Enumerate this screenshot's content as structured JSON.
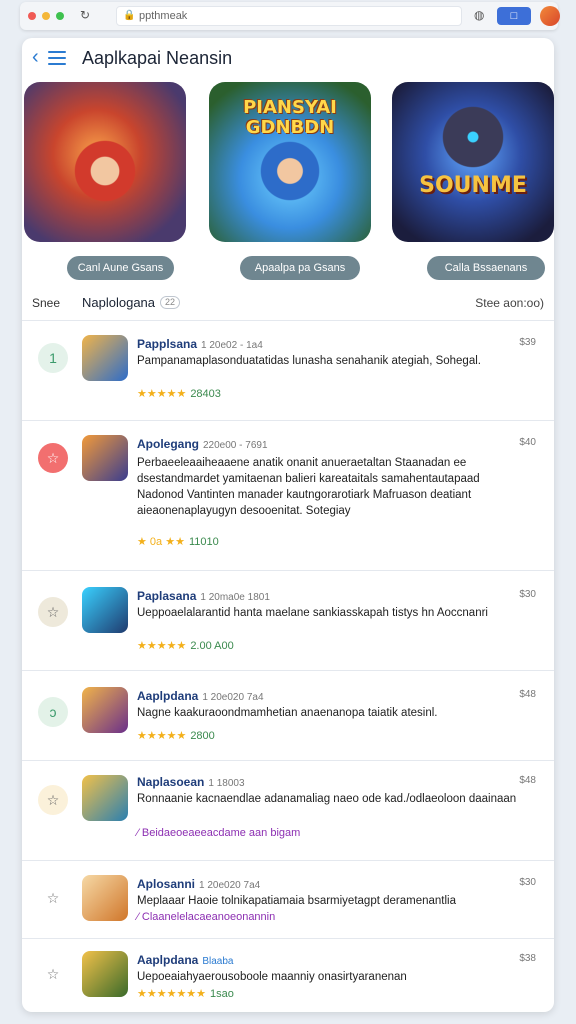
{
  "browser": {
    "url": "ppthmeak",
    "ext_label": "□",
    "profile_initial": "●"
  },
  "header": {
    "title": "Aaplkapai Neansin"
  },
  "hero": [
    {
      "art_text": "",
      "button": "Canl Aune Gsans"
    },
    {
      "art_text": "PIANSYAI GDNBDN",
      "button": "Apaalpa pa Gsans"
    },
    {
      "art_text": "SOUNME",
      "button": "Calla Bssaenans"
    }
  ],
  "filters": {
    "left": "Snee",
    "title": "Naplologana",
    "badge": "22",
    "right": "Stee aon:oo)"
  },
  "rows": [
    {
      "title": "Papplsana",
      "meta": "1 20e02 - 1a4",
      "desc": "Pampanamaplasonduatatidas lunasha senahanik ategiah, Sohegal.",
      "rating": "★★★★★",
      "rating_num": "28403",
      "count": "$39",
      "left_icon": "1",
      "left_bg": "#e4f2ea",
      "left_fg": "#3b9a6b",
      "thumb": "#2d6cc9"
    },
    {
      "title": "Apolegang",
      "meta": "220e00 - 7691",
      "desc": "Perbaeeleaaiheaaene anatik onanit anueraetaltan Staanadan ee dsestandmardet yamitaenan balieri kareataitals samahentautapaad Nadonod Vantinten manader kautngorarotiark Mafruason deatiant aieaonenaplayugyn desooenitat. Sotegiay",
      "rating": "★ 0a  ★★",
      "rating_num": "11010",
      "count": "$40",
      "left_icon": "☆",
      "left_bg": "#f26f6f",
      "left_fg": "#ffffff",
      "thumb": "#3a3d8f"
    },
    {
      "title": "Paplasana",
      "meta": "1 20ma0e 1801",
      "desc": "Ueppoaelalarantid hanta maelane sankiasskapah tistys hn Aoccnanri",
      "rating": "★★★★★",
      "rating_num": "2.00 A00",
      "count": "$30",
      "left_icon": "☆",
      "left_bg": "#eee9db",
      "left_fg": "#666666",
      "thumb": "#1f3a6e"
    },
    {
      "title": "Aaplpdana",
      "meta": "1 20e020 7a4",
      "desc": "Nagne kaakuraoondmamhetian anaenanopa taiatik atesinl.",
      "rating": "★★★★★",
      "rating_num": "2800",
      "count": "$48",
      "left_icon": "ↄ",
      "left_bg": "#e3f2e8",
      "left_fg": "#3b9a6b",
      "thumb": "#6a2f8a"
    },
    {
      "title": "Naplasoean",
      "meta": "1 18003",
      "desc": "Ronnaanie kacnaendlae adanamaliag naeo ode kad./odlaeoloon daainaan",
      "link": "⁄ Beidaeoeaeeacdame aan bigam",
      "count": "$48",
      "left_icon": "☆",
      "left_bg": "#fbf1da",
      "left_fg": "#666666",
      "thumb": "#2a7fb0"
    },
    {
      "title": "Aplosanni",
      "meta": "1 20e020 7a4",
      "desc": "Meplaaar Haoie tolnikapatiamaia bsarmiyetagpt deramenantlia",
      "link": "⁄ Claanelelacaeanoeonannin",
      "count": "$30",
      "left_icon": "☆",
      "left_bg": "#ffffff",
      "left_fg": "#777777",
      "thumb": "#d0762a"
    },
    {
      "title": "Aaplpdana",
      "meta_accent": "Blaaba",
      "desc": "Uepoeaiahyaerousoboole maanniy onasirtyaranenan",
      "rating": "★★★★★★★",
      "rating_num": "1sao",
      "count": "$38",
      "left_icon": "☆",
      "left_bg": "#ffffff",
      "left_fg": "#777777",
      "thumb": "#3a6a2a"
    }
  ]
}
